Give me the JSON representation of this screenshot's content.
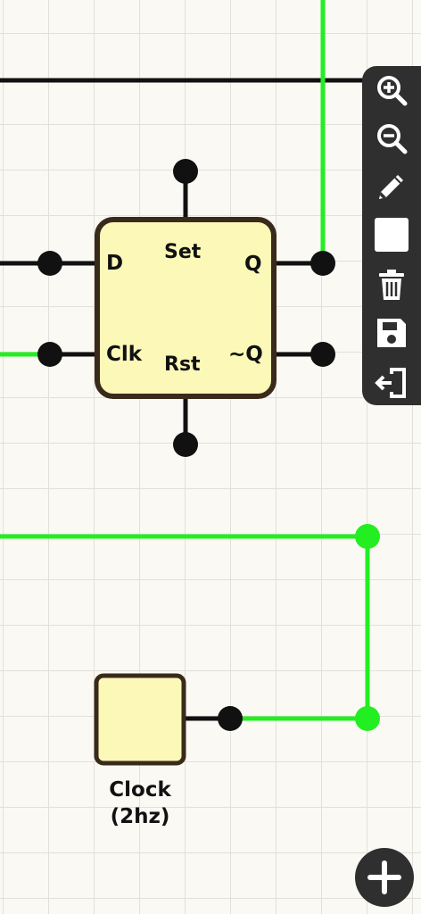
{
  "colors": {
    "wire_off": "#111111",
    "wire_on": "#22ee22",
    "component_fill": "#fbf8b8",
    "component_border": "#3a2a1a",
    "toolbar_bg": "#2f2f2f",
    "toolbar_icon": "#ffffff"
  },
  "flipflop": {
    "pins": {
      "d": "D",
      "clk": "Clk",
      "set": "Set",
      "rst": "Rst",
      "q": "Q",
      "qbar": "~Q"
    }
  },
  "clock": {
    "label_line1": "Clock",
    "label_line2": "(2hz)"
  },
  "toolbar": {
    "tools": [
      {
        "name": "zoom-in-icon"
      },
      {
        "name": "zoom-out-icon"
      },
      {
        "name": "pencil-icon"
      },
      {
        "name": "select-square-icon"
      },
      {
        "name": "trash-icon"
      },
      {
        "name": "save-icon"
      },
      {
        "name": "exit-icon"
      }
    ]
  },
  "add_button": {
    "icon": "plus-icon"
  }
}
